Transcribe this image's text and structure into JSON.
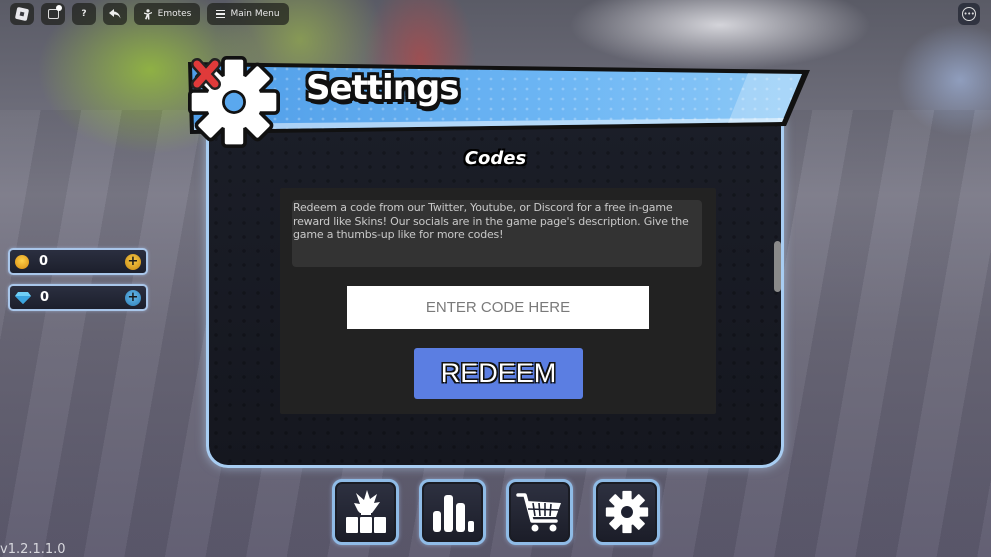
{
  "topbar": {
    "emotes_label": "Emotes",
    "main_menu_label": "Main Menu",
    "help_label": "?",
    "more_label": "•••"
  },
  "currency": {
    "coins": "0",
    "gems": "0",
    "plus_label": "+"
  },
  "modal": {
    "title": "Settings",
    "section_title": "Codes",
    "description": "Redeem a code from our Twitter, Youtube, or Discord for a free in-game reward like Skins! Our socials are in the game page's description. Give the game a thumbs-up like for more codes!",
    "code_input_placeholder": "ENTER CODE HERE",
    "code_input_value": "",
    "redeem_label": "REDEEM"
  },
  "bottom_nav": [
    {
      "name": "character",
      "icon": "character-icon"
    },
    {
      "name": "leaderboard",
      "icon": "bar-chart-icon"
    },
    {
      "name": "shop",
      "icon": "shopping-cart-icon"
    },
    {
      "name": "settings",
      "icon": "gear-icon"
    }
  ],
  "version": "v1.2.1.1.0",
  "colors": {
    "header_blue": "#5aa8ee",
    "redeem_blue": "#5b7ee2",
    "close_red": "#e03a3a",
    "modal_border": "#a8cdf2",
    "panel_bg": "#222222"
  }
}
